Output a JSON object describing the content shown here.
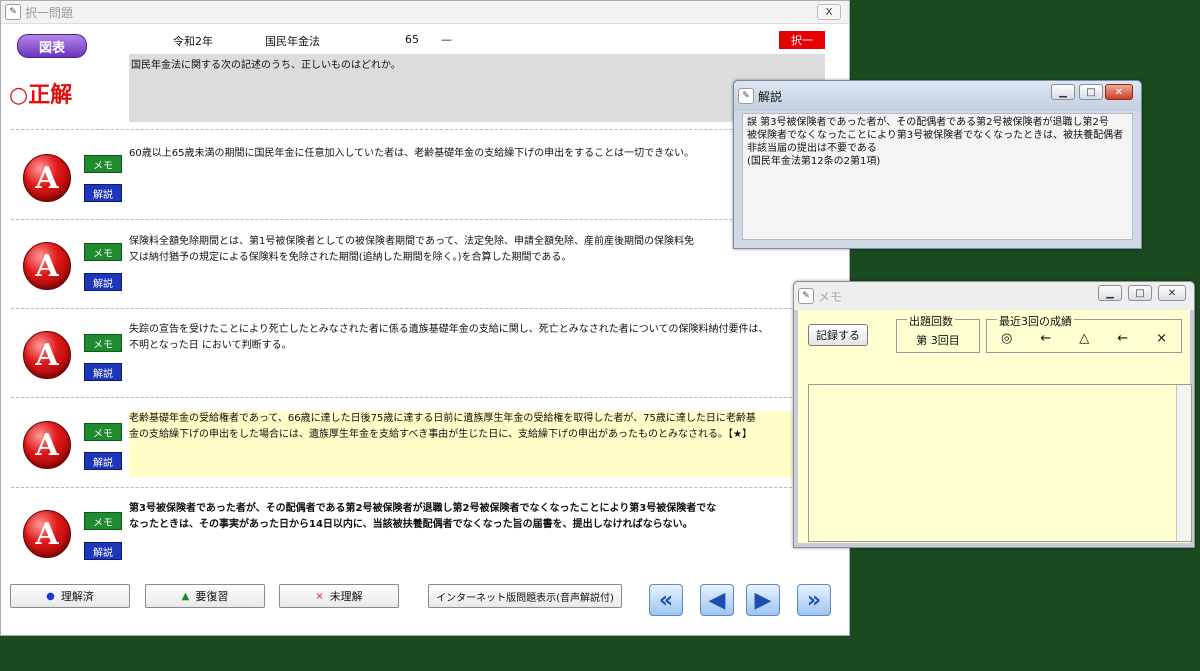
{
  "main_window": {
    "title": "択一問題",
    "close_label": "X"
  },
  "header": {
    "era": "令和2年",
    "law": "国民年金法",
    "number": "65",
    "dash": "—",
    "mode_button": "択一"
  },
  "zuhyo_button": "図表",
  "verdict": {
    "mark": "○",
    "label": "正解"
  },
  "question": "国民年金法に関する次の記述のうち、正しいものはどれか。",
  "choice_icon_letter": "A",
  "memo_button_label": "メモ",
  "kaisetsu_button_label": "解説",
  "choices": [
    {
      "text_lines": [
        "60歳以上65歳未満の期間に国民年金に任意加入していた者は、老齢基礎年金の支給繰下げの申出をすることは一切できない。"
      ]
    },
    {
      "text_lines": [
        "保険料全額免除期間とは、第1号被保険者としての被保険者期間であって、法定免除、申請全額免除、産前産後期間の保険料免",
        "又は納付猶予の規定による保険料を免除された期間(追納した期間を除く。)を合算した期間である。"
      ]
    },
    {
      "text_lines": [
        "失踪の宣告を受けたことにより死亡したとみなされた者に係る遺族基礎年金の支給に関し、死亡とみなされた者についての保険料納付要件は、",
        "不明となった日 において判断する。"
      ]
    },
    {
      "text_lines": [
        "老齢基礎年金の受給権者であって、66歳に達した日後75歳に達する日前に遺族厚生年金の受給権を取得した者が、75歳に達した日に老齢基",
        "金の支給繰下げの申出をした場合には、遺族厚生年金を支給すべき事由が生じた日に、支給繰下げの申出があったものとみなされる。【★】"
      ]
    },
    {
      "text_lines": [
        "第3号被保険者であった者が、その配偶者である第2号被保険者が退職し第2号被保険者でなくなったことにより第3号被保険者でな",
        "なったときは、その事実があった日から14日以内に、当該被扶養配偶者でなくなった旨の届書を、提出しなければならない。"
      ]
    }
  ],
  "bottom_buttons": {
    "understood": {
      "glyph": "●",
      "label": "理解済"
    },
    "review": {
      "glyph": "▲",
      "label": "要復習"
    },
    "not_understood": {
      "glyph": "×",
      "label": "未理解"
    },
    "internet": "インターネット版問題表示(音声解説付)"
  },
  "nav": {
    "first": "«",
    "prev": "◀",
    "next": "▶",
    "last": "»"
  },
  "kaisetsu_window": {
    "title": "解説",
    "lines": [
      "誤 第3号被保険者であった者が、その配偶者である第2号被保険者が退職し第2号",
      "被保険者でなくなったことにより第3号被保険者でなくなったときは、被扶養配偶者",
      "非該当届の提出は不要である",
      "(国民年金法第12条の2第1項)"
    ]
  },
  "memo_window": {
    "title": "メモ",
    "record_button": "記録する",
    "count_label": "出題回数",
    "count_value": "第 3回目",
    "recent_label": "最近3回の成績",
    "results": [
      "◎",
      "←",
      "△",
      "←",
      "×"
    ]
  },
  "colors": {
    "desktop": "#1a4a20",
    "correct_red": "#e01010",
    "memo_green": "#1f8a30",
    "kaisetsu_blue": "#1e36b8",
    "highlight": "#fffdc8"
  }
}
